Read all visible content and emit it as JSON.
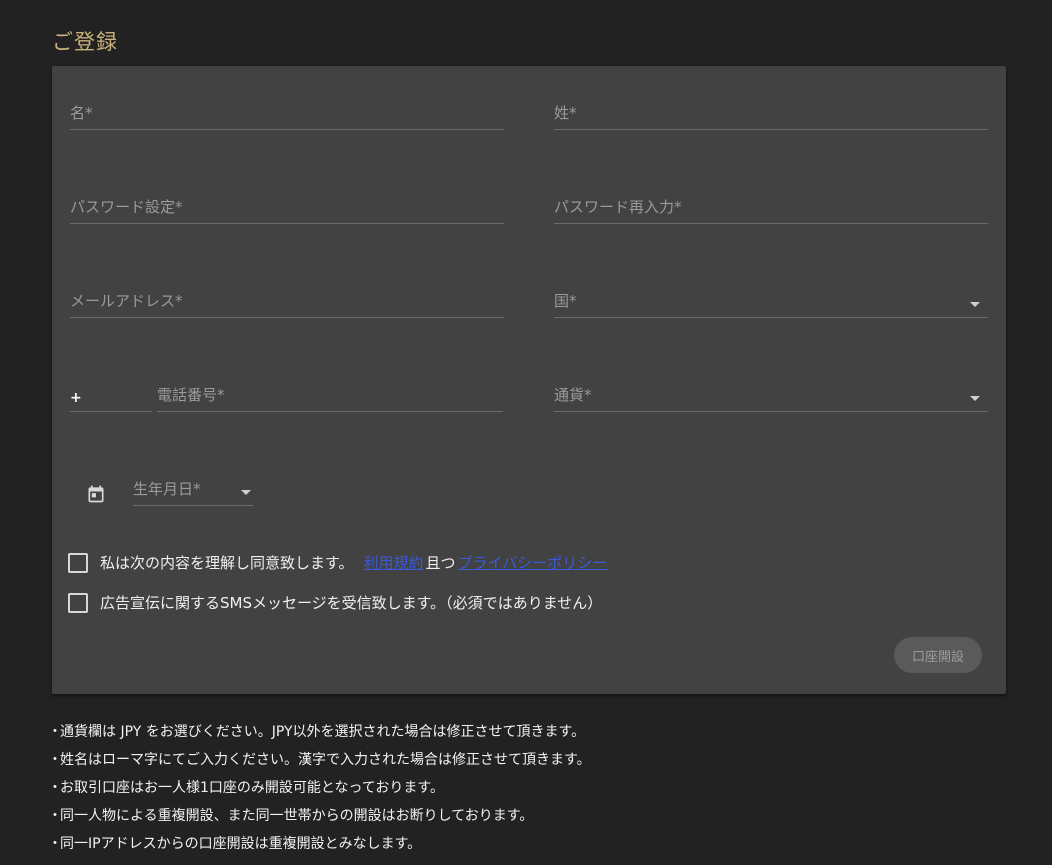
{
  "page": {
    "title": "ご登録"
  },
  "form": {
    "first_name_label": "名*",
    "last_name_label": "姓*",
    "password_label": "パスワード設定*",
    "password_confirm_label": "パスワード再入力*",
    "email_label": "メールアドレス*",
    "country_label": "国*",
    "phone_prefix": "+",
    "phone_label": "電話番号*",
    "currency_label": "通貨*",
    "birthdate_label": "生年月日*",
    "agree_text": "私は次の内容を理解し同意致します。",
    "terms_link": "利用規約",
    "and_text": "且つ",
    "privacy_link": "プライバシーポリシー",
    "sms_text": "広告宣伝に関するSMSメッセージを受信致します。（必須ではありません）",
    "submit_label": "口座開設"
  },
  "icons": {
    "calendar": "calendar-icon",
    "dropdown": "chevron-down-icon"
  },
  "colors": {
    "background": "#222222",
    "card": "#424242",
    "title": "#c9b27a",
    "link": "#3a5ad8"
  },
  "notes": [
    "通貨欄は JPY をお選びください。JPY以外を選択された場合は修正させて頂きます。",
    "姓名はローマ字にてご入力ください。漢字で入力された場合は修正させて頂きます。",
    "お取引口座はお一人様1口座のみ開設可能となっております。",
    "同一人物による重複開設、また同一世帯からの開設はお断りしております。",
    "同一IPアドレスからの口座開設は重複開設とみなします。"
  ]
}
